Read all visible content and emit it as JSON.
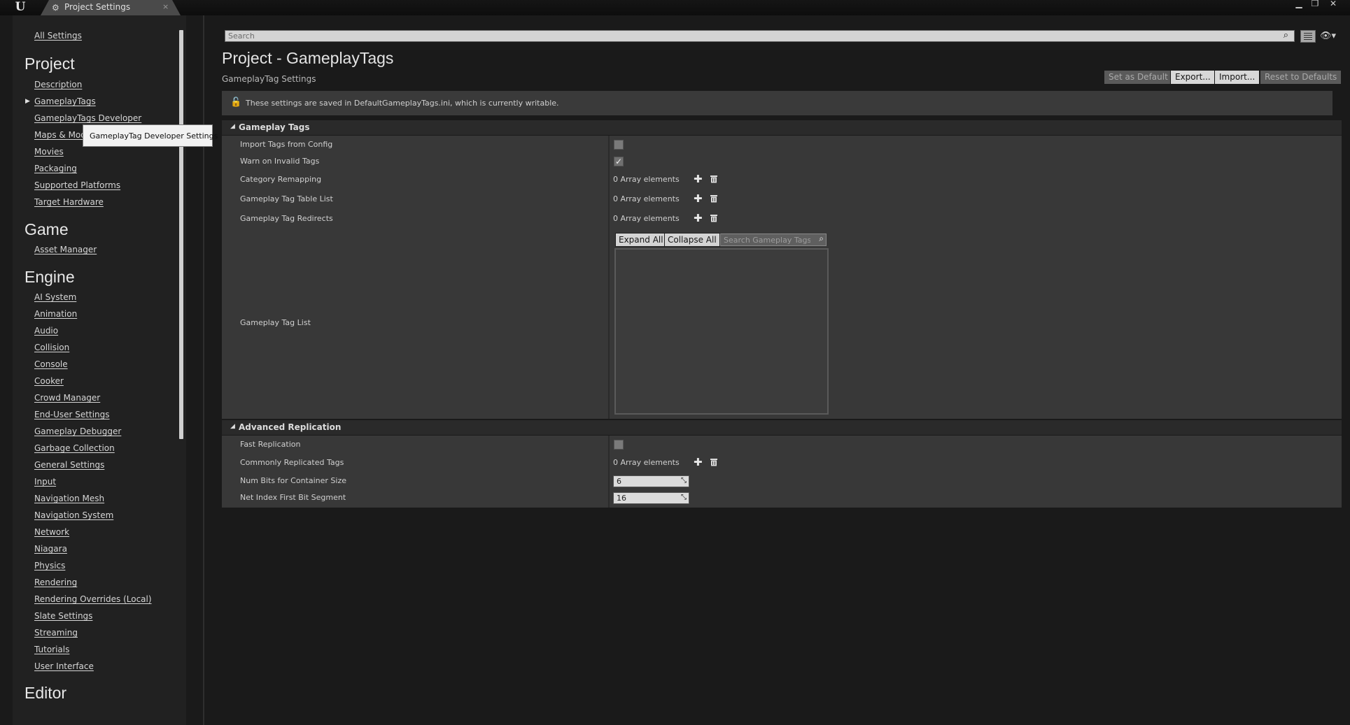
{
  "window": {
    "tab_title": "Project Settings",
    "tab_icon": "gear-icon",
    "close_glyph": "×",
    "logo_text": "U",
    "controls": [
      "minimize",
      "restore",
      "close"
    ]
  },
  "sidebar": {
    "all_settings": "All Settings",
    "headings": [
      "Project",
      "Game",
      "Engine",
      "Editor"
    ],
    "project_items": [
      "Description",
      "GameplayTags",
      "GameplayTags Developer",
      "Maps & Modes",
      "Movies",
      "Packaging",
      "Supported Platforms",
      "Target Hardware"
    ],
    "game_items": [
      "Asset Manager"
    ],
    "engine_items": [
      "AI System",
      "Animation",
      "Audio",
      "Collision",
      "Console",
      "Cooker",
      "Crowd Manager",
      "End-User Settings",
      "Gameplay Debugger",
      "Garbage Collection",
      "General Settings",
      "Input",
      "Navigation Mesh",
      "Navigation System",
      "Network",
      "Niagara",
      "Physics",
      "Rendering",
      "Rendering Overrides (Local)",
      "Slate Settings",
      "Streaming",
      "Tutorials",
      "User Interface"
    ],
    "tooltip": "GameplayTag Developer Settings",
    "maps_partial": "Maps & Mod"
  },
  "search": {
    "placeholder": "Search"
  },
  "main": {
    "title": "Project - GameplayTags",
    "subtitle": "GameplayTag Settings",
    "buttons": {
      "set_default": "Set as Default",
      "export": "Export...",
      "import": "Import...",
      "reset": "Reset to Defaults"
    },
    "info": "These settings are saved in DefaultGameplayTags.ini, which is currently writable."
  },
  "gameplay_tags": {
    "header": "Gameplay Tags",
    "import_tags_label": "Import Tags from Config",
    "import_tags_checked": false,
    "warn_invalid_label": "Warn on Invalid Tags",
    "warn_invalid_checked": true,
    "category_remapping_label": "Category Remapping",
    "tag_table_list_label": "Gameplay Tag Table List",
    "tag_redirects_label": "Gameplay Tag Redirects",
    "array_text": "0 Array elements",
    "tag_list_label": "Gameplay Tag List",
    "expand_all": "Expand All",
    "collapse_all": "Collapse All",
    "tag_search_placeholder": "Search Gameplay Tags"
  },
  "advanced_replication": {
    "header": "Advanced Replication",
    "fast_replication_label": "Fast Replication",
    "fast_replication_checked": false,
    "commonly_replicated_label": "Commonly Replicated Tags",
    "array_text": "0 Array elements",
    "num_bits_label": "Num Bits for Container Size",
    "num_bits_value": "6",
    "net_index_label": "Net Index First Bit Segment",
    "net_index_value": "16"
  }
}
